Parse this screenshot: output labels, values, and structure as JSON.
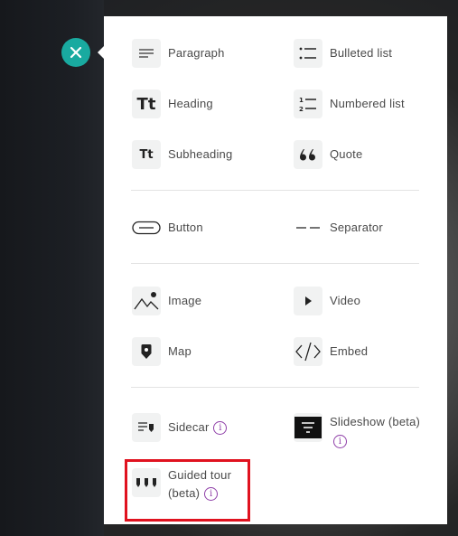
{
  "close_button": {
    "icon": "close-icon",
    "color": "#19aaa0"
  },
  "items": {
    "paragraph": "Paragraph",
    "bulleted_list": "Bulleted list",
    "heading": "Heading",
    "heading_glyph": "Tt",
    "numbered_list": "Numbered list",
    "subheading": "Subheading",
    "subheading_glyph": "Tt",
    "quote": "Quote",
    "button": "Button",
    "separator": "Separator",
    "image": "Image",
    "video": "Video",
    "map": "Map",
    "embed": "Embed",
    "sidecar": "Sidecar",
    "slideshow_line1": "Slideshow (beta)",
    "guided_tour_line1": "Guided tour",
    "guided_tour_line2": "(beta)"
  },
  "info_glyph": "i",
  "highlight_color": "#e0121f"
}
